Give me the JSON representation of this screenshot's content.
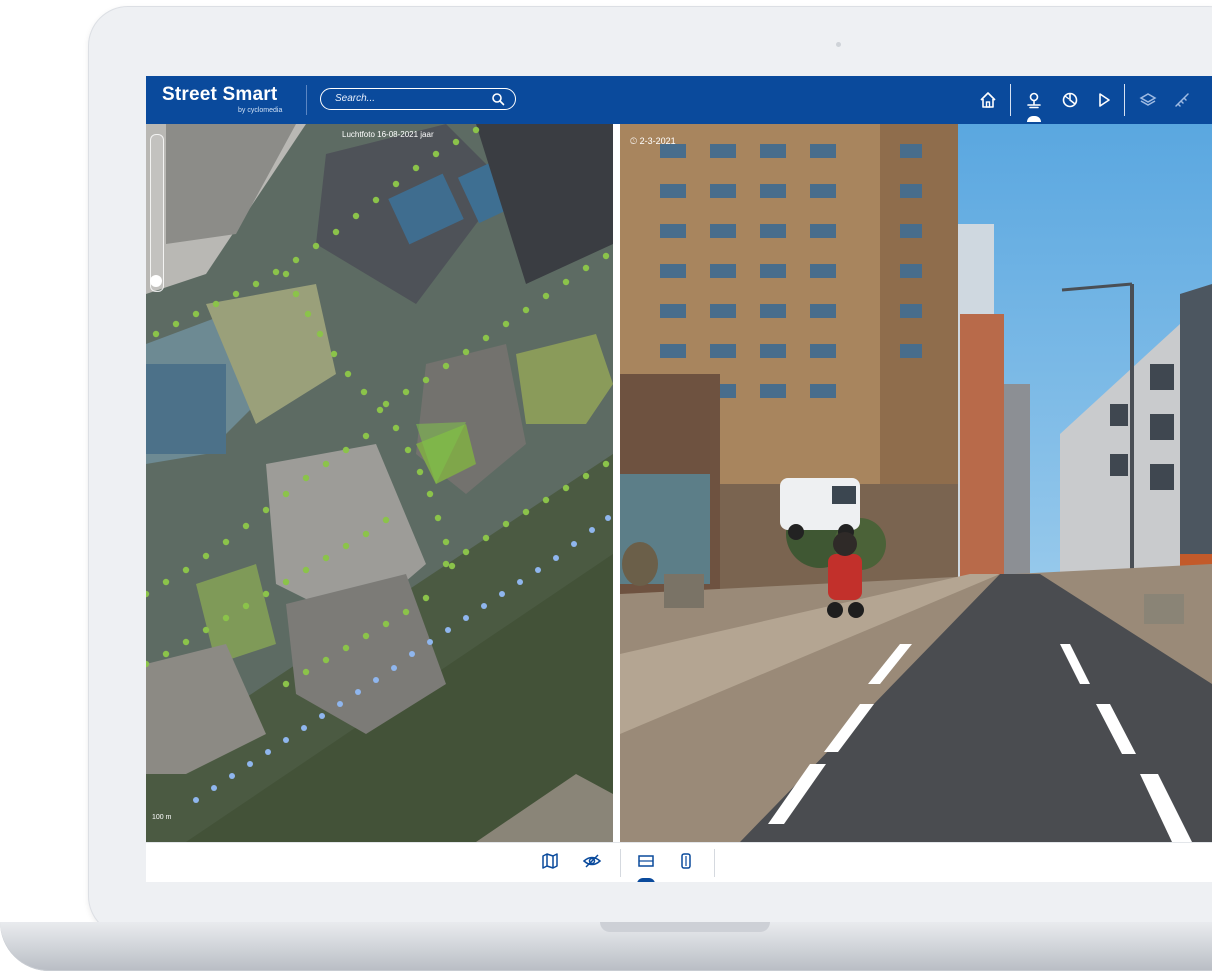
{
  "app": {
    "name": "Street Smart",
    "subtitle": "by cyclomedia"
  },
  "search": {
    "placeholder": "Search..."
  },
  "toolbar": {
    "icons": [
      "home-icon",
      "pano-viewer-icon",
      "layers-globe-icon",
      "play-icon",
      "layers-icon",
      "measure-icon"
    ]
  },
  "map_view": {
    "date_label": "Luchtfoto 16-08-2021 jaar",
    "scale_label": "100 m"
  },
  "pano_view": {
    "capture_date": "2-3-2021"
  },
  "bottom_bar": {
    "icons": [
      "map-icon",
      "hide-visibility-icon",
      "panorama-icon",
      "pointcloud-icon"
    ]
  },
  "colors": {
    "brand_blue": "#0a4a9c",
    "route_green": "#8bc34a",
    "route_blue": "#8fb6ee"
  }
}
